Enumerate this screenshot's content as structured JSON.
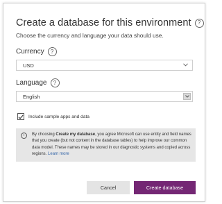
{
  "dialog": {
    "title": "Create a database for this environment",
    "help_glyph": "?",
    "subtitle": "Choose the currency and language your data should use."
  },
  "currency": {
    "label": "Currency",
    "help_glyph": "?",
    "value": "USD"
  },
  "language": {
    "label": "Language",
    "help_glyph": "?",
    "value": "English"
  },
  "sample_apps": {
    "checked": true,
    "label": "Include sample apps and data"
  },
  "info": {
    "icon_glyph": "i",
    "text_before": "By choosing ",
    "bold": "Create my database",
    "text_after": ", you agree Microsoft can use entity and field names that you create (but not content in the database tables) to help improve our common data model. These names may be stored in our diagnostic systems and copied across regions. ",
    "link": "Learn more"
  },
  "buttons": {
    "cancel": "Cancel",
    "create": "Create database"
  },
  "colors": {
    "primary": "#742774",
    "link": "#3566a8",
    "info_bg": "#e6e6e6"
  }
}
